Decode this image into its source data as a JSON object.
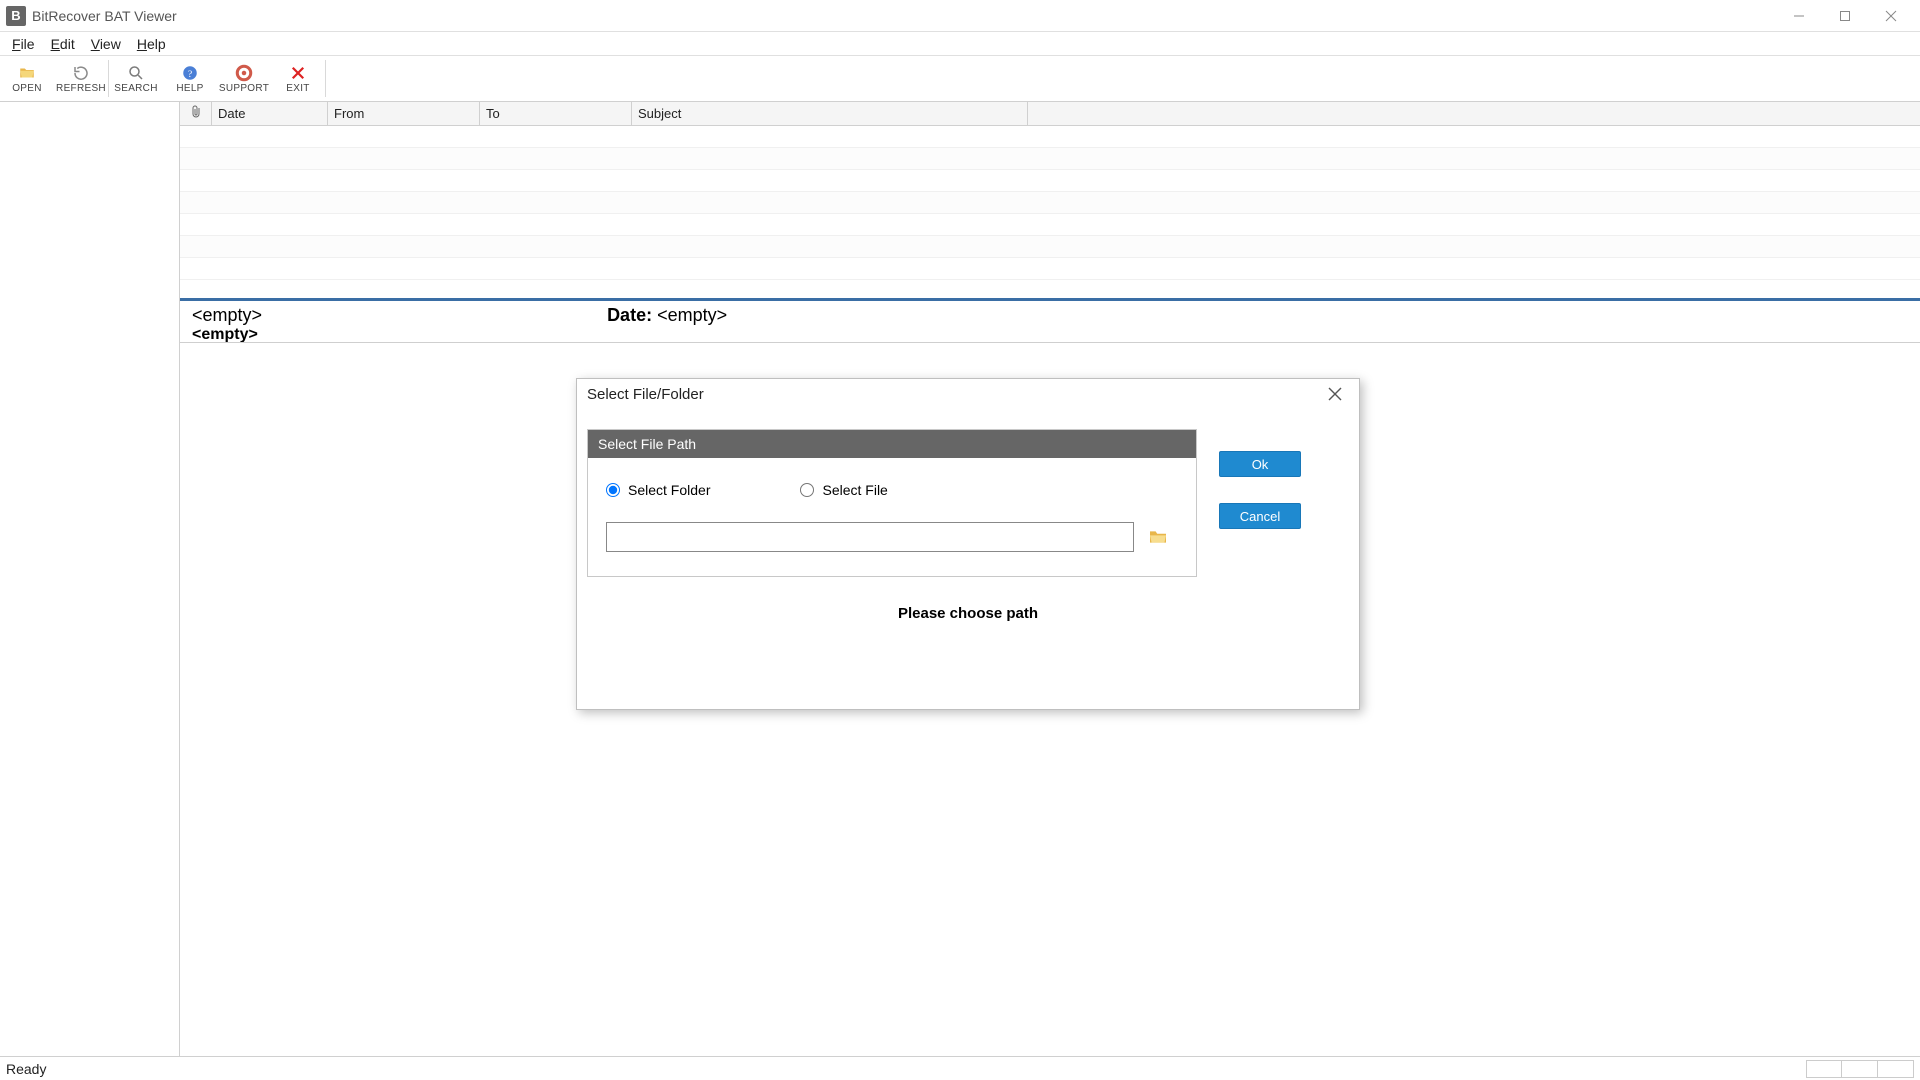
{
  "app": {
    "title": "BitRecover BAT Viewer"
  },
  "menu": {
    "file": "File",
    "edit": "Edit",
    "view": "View",
    "help": "Help"
  },
  "toolbar": {
    "open": "OPEN",
    "refresh": "REFRESH",
    "search": "SEARCH",
    "help": "HELP",
    "support": "SUPPORT",
    "exit": "EXIT"
  },
  "columns": {
    "date": "Date",
    "from": "From",
    "to": "To",
    "subject": "Subject"
  },
  "preview": {
    "line1": "<empty>",
    "line2": "<empty>",
    "date_label": "Date:",
    "date_value": "<empty>"
  },
  "status": {
    "text": "Ready"
  },
  "dialog": {
    "title": "Select File/Folder",
    "group_title": "Select File Path",
    "radio_folder": "Select Folder",
    "radio_file": "Select File",
    "path_value": "",
    "ok": "Ok",
    "cancel": "Cancel",
    "footer": "Please choose path"
  }
}
